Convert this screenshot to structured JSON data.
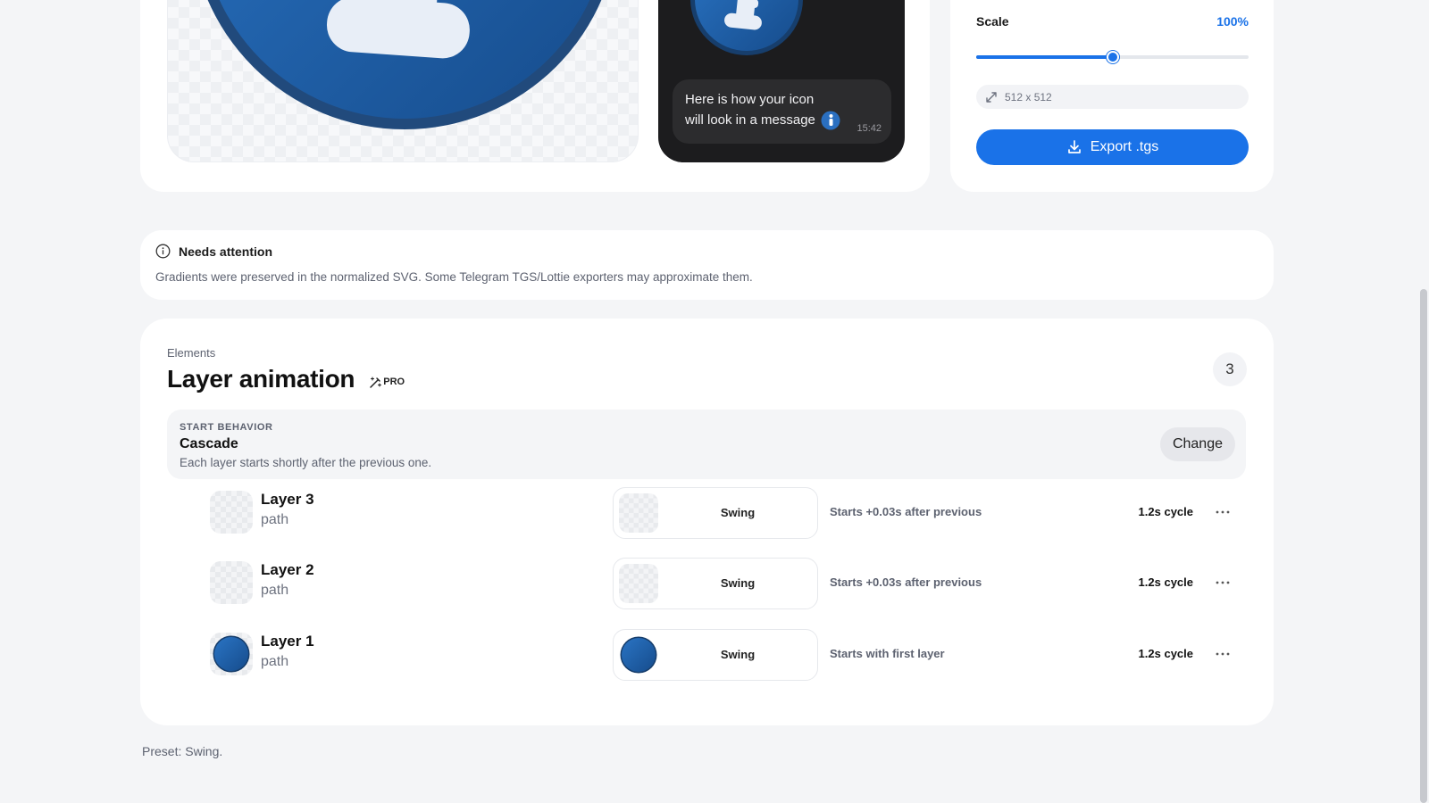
{
  "preview": {
    "phone_message_line1": "Here is how your icon",
    "phone_message_line2": "will look in a message",
    "phone_message_time": "15:42"
  },
  "export": {
    "scale_label": "Scale",
    "scale_value": "100%",
    "scale_fraction": 0.5,
    "size_placeholder": "512 x 512",
    "export_label": "Export .tgs"
  },
  "attention": {
    "title": "Needs attention",
    "text": "Gradients were preserved in the normalized SVG. Some Telegram TGS/Lottie exporters may approximate them."
  },
  "layers": {
    "section_label": "Elements",
    "title": "Layer animation",
    "pro_label": "PRO",
    "count": "3",
    "start_behavior": {
      "label": "START BEHAVIOR",
      "name": "Cascade",
      "description": "Each layer starts shortly after the previous one.",
      "change_label": "Change"
    },
    "items": [
      {
        "name": "Layer 3",
        "type": "path",
        "animation": "Swing",
        "start": "Starts +0.03s after previous",
        "cycle": "1.2s cycle"
      },
      {
        "name": "Layer 2",
        "type": "path",
        "animation": "Swing",
        "start": "Starts +0.03s after previous",
        "cycle": "1.2s cycle"
      },
      {
        "name": "Layer 1",
        "type": "path",
        "animation": "Swing",
        "start": "Starts with first layer",
        "cycle": "1.2s cycle"
      }
    ]
  },
  "preset_note": "Preset: Swing.",
  "colors": {
    "accent": "#1a72e8",
    "icon_blue": "#1e5fa8",
    "icon_dark_blue": "#1b4c8a",
    "phone_bg": "#1c1c1e",
    "page_bg": "#f4f5f7"
  },
  "icons": {
    "attention": "info-circle-icon",
    "export": "download-icon",
    "size": "resize-arrows-icon",
    "pro": "magic-wand-icon",
    "layer_menu": "more-dots-icon"
  }
}
